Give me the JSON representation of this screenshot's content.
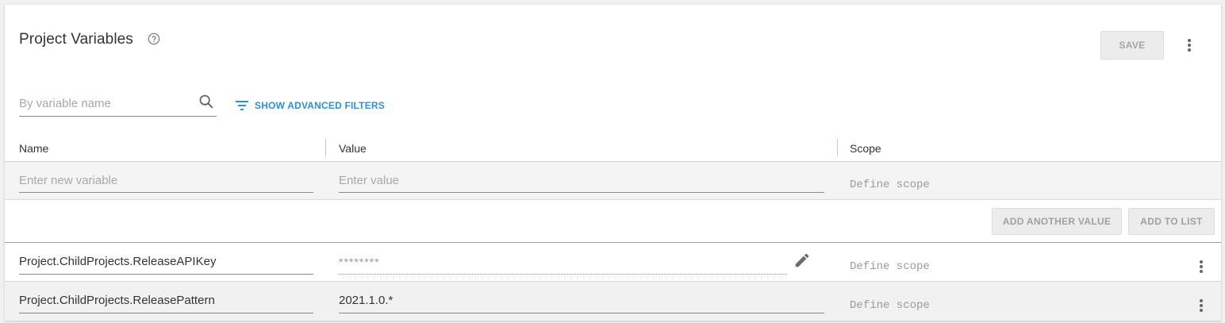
{
  "header": {
    "title": "Project Variables",
    "save_label": "SAVE"
  },
  "filters": {
    "search_placeholder": "By variable name",
    "advanced_label": "SHOW ADVANCED FILTERS"
  },
  "table": {
    "columns": [
      "Name",
      "Value",
      "Scope"
    ],
    "new_row": {
      "name_placeholder": "Enter new variable",
      "value_placeholder": "Enter value",
      "scope_label": "Define scope"
    },
    "actions": {
      "add_another_value": "ADD ANOTHER VALUE",
      "add_to_list": "ADD TO LIST"
    },
    "rows": [
      {
        "name": "Project.ChildProjects.ReleaseAPIKey",
        "value": "********",
        "scope": "Define scope",
        "sensitive": true
      },
      {
        "name": "Project.ChildProjects.ReleasePattern",
        "value": "2021.1.0.*",
        "scope": "Define scope",
        "sensitive": false
      }
    ]
  },
  "icons": {
    "help": "help-circle-icon",
    "search": "search-icon",
    "filter": "filter-list-icon",
    "more": "more-vertical-icon",
    "edit": "pencil-icon"
  },
  "colors": {
    "accent": "#2f8fd7",
    "text": "#333333",
    "muted": "#a8a8a8"
  }
}
